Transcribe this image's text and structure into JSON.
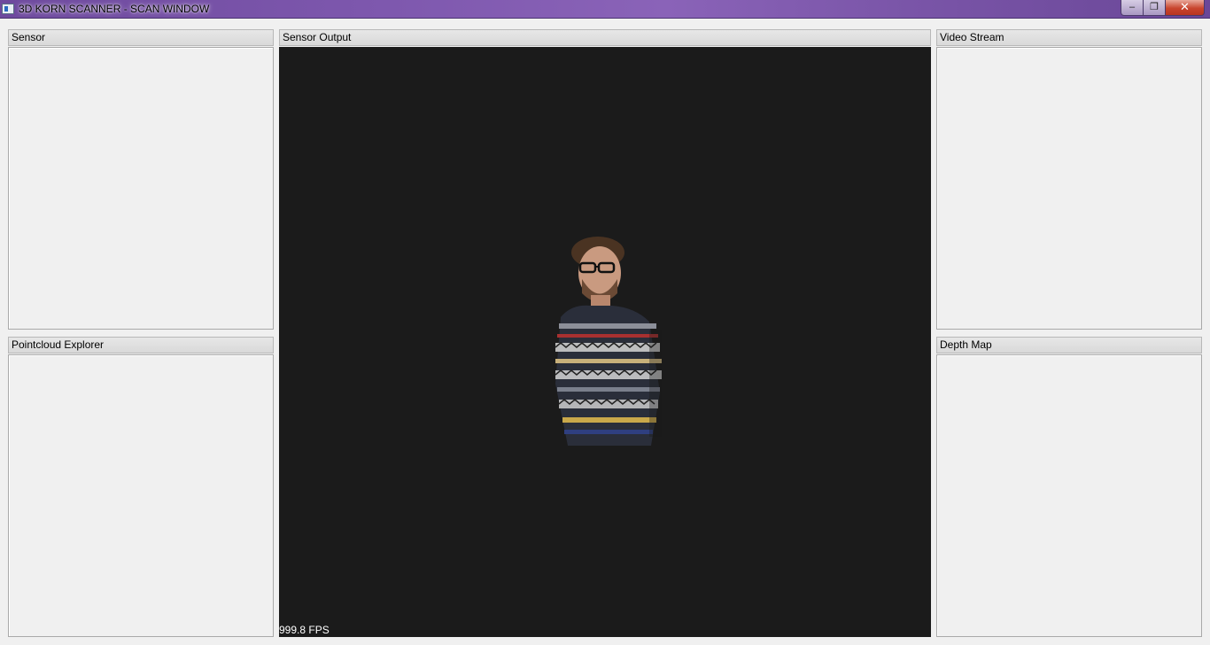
{
  "window": {
    "title": "3D KORN SCANNER - SCAN WINDOW",
    "controls": {
      "minimize": "–",
      "maximize": "❐",
      "close": "✕"
    }
  },
  "panels": {
    "sensor": {
      "title": "Sensor"
    },
    "sensor_output": {
      "title": "Sensor Output",
      "fps": "999.8 FPS"
    },
    "video_stream": {
      "title": "Video Stream"
    },
    "pointcloud_explorer": {
      "title": "Pointcloud Explorer"
    },
    "depth_map": {
      "title": "Depth Map"
    }
  },
  "colors": {
    "titlebar": "#7d57ad",
    "viewport_bg": "#1b1b1b",
    "panel_bg": "#f0f0f0",
    "close_button": "#c8452e"
  }
}
